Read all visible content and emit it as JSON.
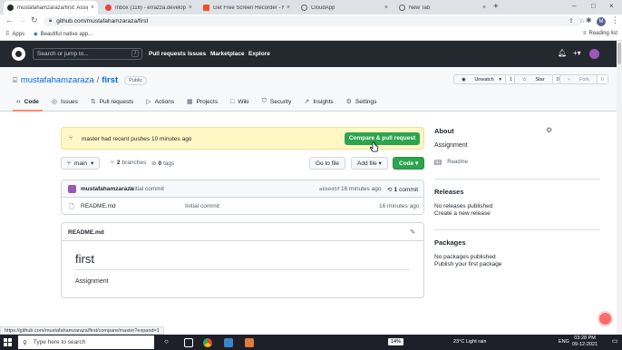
{
  "browser": {
    "tabs": [
      {
        "label": "mustafahamzaraza/first: Assignm...",
        "color": "#24292f",
        "active": true
      },
      {
        "label": "Inbox (116) - errazza.developer@...",
        "color": "#ea4335",
        "active": false
      },
      {
        "label": "Get Free Screen Recorder - Micr...",
        "color": "#f25022",
        "active": false
      },
      {
        "label": "CloudApp",
        "color": "#5f6368",
        "active": false
      },
      {
        "label": "New Tab",
        "color": "#5f6368",
        "active": false
      }
    ],
    "new_tab_glyph": "+",
    "url": "github.com/mustafahamzaraza/first",
    "profile_initial": "M",
    "bookmarks": [
      {
        "label": "Apps"
      },
      {
        "label": "Beautiful native app..."
      }
    ],
    "reading_list": "Reading list",
    "status_url": "https://github.com/mustafahamzaraza/first/compare/master?expand=1"
  },
  "github_header": {
    "search_placeholder": "Search or jump to...",
    "search_shortcut": "/",
    "nav": [
      "Pull requests",
      "Issues",
      "Marketplace",
      "Explore"
    ]
  },
  "repo": {
    "owner": "mustafahamzaraza",
    "separator": "/",
    "name": "first",
    "visibility": "Public",
    "actions": {
      "unwatch_label": "Unwatch",
      "unwatch_count": "1",
      "star_label": "Star",
      "star_count": "0",
      "fork_label": "Fork",
      "fork_count": "0"
    },
    "tabs": [
      {
        "label": "Code",
        "icon": "code-icon",
        "glyph": "‹›"
      },
      {
        "label": "Issues",
        "icon": "issue-icon",
        "glyph": "◎"
      },
      {
        "label": "Pull requests",
        "icon": "pull-request-icon",
        "glyph": "⇅"
      },
      {
        "label": "Actions",
        "icon": "actions-icon",
        "glyph": "▷"
      },
      {
        "label": "Projects",
        "icon": "projects-icon",
        "glyph": "▦"
      },
      {
        "label": "Wiki",
        "icon": "wiki-icon",
        "glyph": "□"
      },
      {
        "label": "Security",
        "icon": "shield-icon",
        "glyph": "⛉"
      },
      {
        "label": "Insights",
        "icon": "graph-icon",
        "glyph": "↗"
      },
      {
        "label": "Settings",
        "icon": "gear-icon",
        "glyph": "⚙"
      }
    ]
  },
  "flash": {
    "branch": "master",
    "message": "had recent pushes 10 minutes ago",
    "compare_label": "Compare & pull request"
  },
  "controls": {
    "branch": "main",
    "branches_count": "2",
    "branches_label": "branches",
    "tags_count": "0",
    "tags_label": "tags",
    "go_to_file": "Go to file",
    "add_file": "Add file",
    "code": "Code"
  },
  "commit": {
    "author": "mustafahamzaraza",
    "message": "Initial commit",
    "sha": "a6b0d5f",
    "age": "16 minutes ago",
    "count_num": "1",
    "count_label": "commit"
  },
  "files": [
    {
      "name": "README.md",
      "message": "Initial commit",
      "age": "16 minutes ago"
    }
  ],
  "readme": {
    "title": "README.md",
    "heading": "first",
    "body": "Assignment"
  },
  "sidebar": {
    "about_title": "About",
    "description": "Assignment",
    "readme_link": "Readme",
    "releases_title": "Releases",
    "releases_none": "No releases published",
    "releases_link": "Create a new release",
    "packages_title": "Packages",
    "packages_none": "No packages published",
    "packages_link": "Publish your first package"
  },
  "taskbar": {
    "search_placeholder": "Type here to search",
    "battery": "14%",
    "weather": "23°C  Light rain",
    "lang": "ENG",
    "time": "03:28 PM",
    "date": "09-12-2021"
  }
}
